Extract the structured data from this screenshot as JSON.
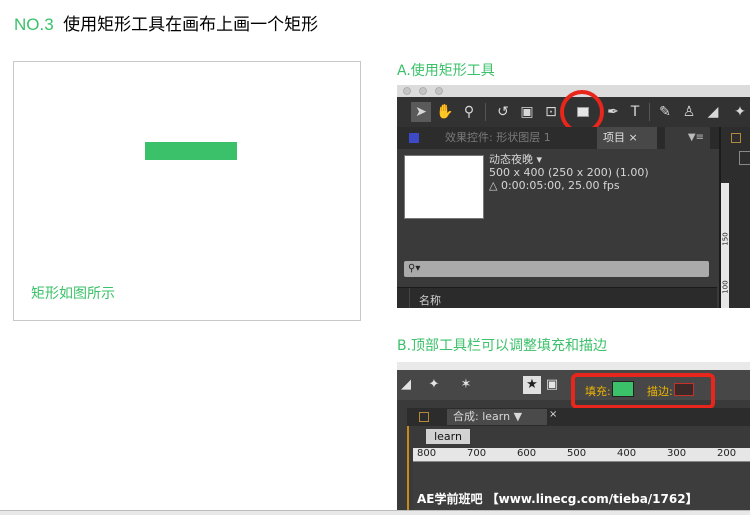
{
  "header": {
    "no": "NO.3",
    "title": "使用矩形工具在画布上画一个矩形"
  },
  "demo": {
    "caption": "矩形如图所示",
    "rect_color": "#3bc16a"
  },
  "section_a": {
    "label": "A.使用矩形工具",
    "tab_effects": "效果控件: 形状图层 1",
    "tab_project": "项目 ×",
    "tab_menu": "▼≡",
    "comp_name": "动态夜晚 ▾",
    "comp_size": "500 x 400  (250 x 200) (1.00)",
    "comp_duration": "△ 0:00:05:00, 25.00 fps",
    "search_icon": "⚲▾",
    "list_column": "名称",
    "ruler_marks": [
      "150",
      "100"
    ],
    "icons": [
      "selection-tool-icon",
      "hand-tool-icon",
      "zoom-tool-icon",
      "rotate-tool-icon",
      "camera-tool-icon",
      "pan-behind-tool-icon",
      "rectangle-tool-icon",
      "pen-tool-icon",
      "text-tool-icon",
      "brush-tool-icon",
      "clone-stamp-tool-icon",
      "eraser-tool-icon",
      "puppet-tool-icon"
    ]
  },
  "section_b": {
    "label": "B.顶部工具栏可以调整填充和描边",
    "fill_label": "填充:",
    "stroke_label": "描边:",
    "fill_color": "#3bc16a",
    "comp_tab": "合成: learn  ▼",
    "comp_close": "×",
    "learn": "learn",
    "ruler_marks": [
      "800",
      "700",
      "600",
      "500",
      "400",
      "300",
      "200"
    ],
    "watermark": "AE学前班吧 【www.linecg.com/tieba/1762】"
  }
}
